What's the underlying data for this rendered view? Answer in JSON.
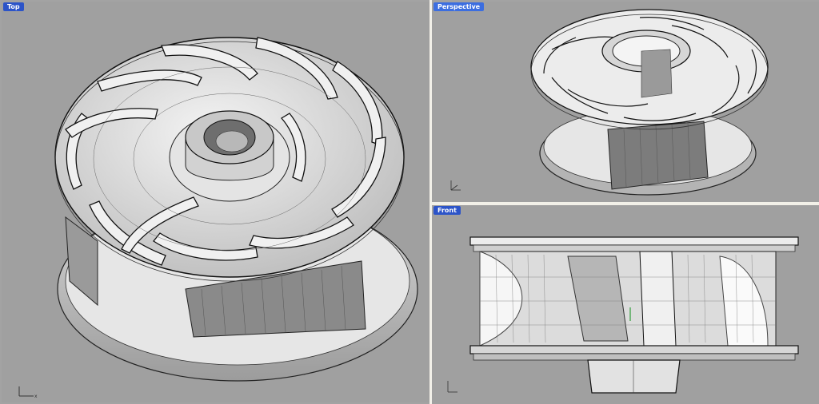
{
  "viewports": {
    "top": {
      "label": "Top"
    },
    "perspective": {
      "label": "Perspective"
    },
    "front": {
      "label": "Front"
    }
  },
  "colors": {
    "viewport_bg": "#a0a0a0",
    "divider": "#f2f0e8",
    "tab_active": "#2c54c8",
    "model_shade": "#e8e8e8",
    "model_edge": "#1a1a1a"
  },
  "icons": [
    "axis-triad-icon"
  ]
}
